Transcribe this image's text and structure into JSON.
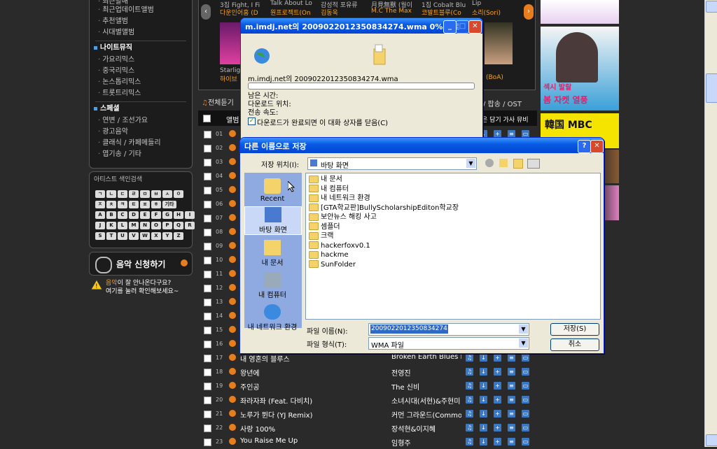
{
  "sidebar": {
    "items_top": [
      "최근발매",
      "최근업데이트앨범",
      "추천앨범",
      "시대별앨범"
    ],
    "section_night": "나이트뮤직",
    "items_night": [
      "가요리믹스",
      "중국리믹스",
      "논스톱리믹스",
      "트롯트리믹스"
    ],
    "section_etc": "스페셜",
    "items_etc": [
      "연변 / 조선가요",
      "광고음악",
      "클래식 / 카페메들리",
      "엽기송 / 기타"
    ],
    "artist_search_title": "아티스트 색인검색",
    "keys": [
      "ㄱ",
      "ㄴ",
      "ㄷ",
      "ㄹ",
      "ㅁ",
      "ㅂ",
      "ㅅ",
      "ㅇ",
      "ㅈ",
      "ㅊ",
      "ㅋ",
      "ㅌ",
      "ㅍ",
      "ㅎ",
      "기타",
      "A",
      "B",
      "C",
      "D",
      "E",
      "F",
      "G",
      "H",
      "I",
      "J",
      "K",
      "L",
      "M",
      "N",
      "O",
      "P",
      "Q",
      "R",
      "S",
      "T",
      "U",
      "V",
      "W",
      "X",
      "Y",
      "Z"
    ],
    "request_label": "음악 신청하기",
    "warn_line1_orange": "음악",
    "warn_line1_rest": "이 잘 안나온다구요?",
    "warn_line2": "여기를 눌러 확인해보세요~"
  },
  "carousel": {
    "items": [
      {
        "t1": "3집 Fight, I Fi",
        "t2": "다운인어홈 (D"
      },
      {
        "t1": "Talk About Lo",
        "t2": "원프로젝트(On"
      },
      {
        "t1": "감성적 포유류",
        "t2": "김동욱"
      },
      {
        "t1": "月見無獸 (월이",
        "t2": "M.C The Max"
      },
      {
        "t1": "1집 Cobalt Blu",
        "t2": "코발트블루(Co"
      },
      {
        "t1": "Lip",
        "t2": "소리(Sori)"
      }
    ],
    "bottom_left_t1": "Starlig",
    "bottom_left_t2": "하이브",
    "bottom_right": "(BoA)",
    "prev": "‹",
    "next": "›"
  },
  "list": {
    "tab_all": "전체듣기",
    "tab_right": "/ 팝송 / OST",
    "head_album": "앨범",
    "head_actions": "은 담기 가사 뮤비",
    "rows": [
      {
        "num": "01",
        "title": "",
        "artist": ""
      },
      {
        "num": "02",
        "title": "",
        "artist": ""
      },
      {
        "num": "03",
        "title": "",
        "artist": ""
      },
      {
        "num": "04",
        "title": "",
        "artist": ""
      },
      {
        "num": "05",
        "title": "",
        "artist": ""
      },
      {
        "num": "06",
        "title": "",
        "artist": ""
      },
      {
        "num": "07",
        "title": "",
        "artist": ""
      },
      {
        "num": "08",
        "title": "",
        "artist": ""
      },
      {
        "num": "09",
        "title": "",
        "artist": ""
      },
      {
        "num": "10",
        "title": "",
        "artist": ""
      },
      {
        "num": "11",
        "title": "",
        "artist": ""
      },
      {
        "num": "12",
        "title": "",
        "artist": ""
      },
      {
        "num": "13",
        "title": "",
        "artist": ""
      },
      {
        "num": "14",
        "title": "",
        "artist": ""
      },
      {
        "num": "15",
        "title": "",
        "artist": ""
      },
      {
        "num": "16",
        "title": "",
        "artist": ""
      },
      {
        "num": "17",
        "title": "내 영혼의 블루스",
        "artist": "Broken Earth Blues Ba"
      },
      {
        "num": "18",
        "title": "왕년에",
        "artist": "전영진"
      },
      {
        "num": "19",
        "title": "주인공",
        "artist": "The 신비"
      },
      {
        "num": "20",
        "title": "좌라자좌 (Feat. 다비치)",
        "artist": "소녀시대(서현)&주현미"
      },
      {
        "num": "21",
        "title": "노루가 뛴다 (YJ Remix)",
        "artist": "커먼 그라운드(Commo"
      },
      {
        "num": "22",
        "title": "사랑 100%",
        "artist": "장석현&이지혜"
      },
      {
        "num": "23",
        "title": "You Raise Me Up",
        "artist": "임형주"
      }
    ]
  },
  "ads": {
    "ad2_line1": "섹시 발랄",
    "ad2_line2": "봄 자켓 열풍",
    "ad3": "韓国 MBC"
  },
  "download_dialog": {
    "title": "m.imdj.net의 20090220123508342​74.wma 0% 완료",
    "filename_line": "m.imdj.net의 2009022012350834274.wma",
    "progress": 0,
    "time_left_label": "남은 시간:",
    "dest_label": "다운로드 위치:",
    "rate_label": "전송 속도:",
    "close_on_complete": "다운로드가 완료되면 이 대화 상자를 닫음(C)"
  },
  "save_dialog": {
    "title": "다른 이름으로 저장",
    "save_in_label": "저장 위치(I):",
    "save_in_value": "바탕 화면",
    "places": [
      "Recent",
      "바탕 화면",
      "내 문서",
      "내 컴퓨터",
      "내 네트워크 환경"
    ],
    "files": [
      "내 문서",
      "내 컴퓨터",
      "내 네트워크 환경",
      "[GTA학교판]BullyScholarshipEditon학교장",
      "보안뉴스 해킹 사고",
      "셈플더",
      "크랙",
      "hackerfoxv0.1",
      "hackme",
      "SunFolder"
    ],
    "filename_label": "파일 이름(N):",
    "filename_value": "2009022012350834274",
    "filetype_label": "파일 형식(T):",
    "filetype_value": "WMA 파일",
    "save_button": "저장(S)",
    "cancel_button": "취소",
    "help": "?",
    "close": "✕"
  }
}
